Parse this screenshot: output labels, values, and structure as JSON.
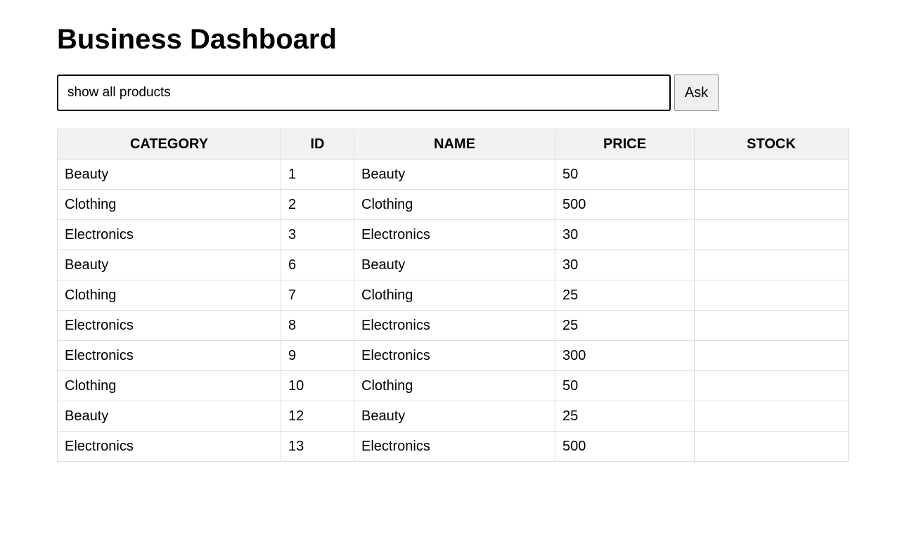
{
  "header": {
    "title": "Business Dashboard"
  },
  "query": {
    "value": "show all products",
    "ask_label": "Ask"
  },
  "table": {
    "columns": [
      "CATEGORY",
      "ID",
      "NAME",
      "PRICE",
      "STOCK"
    ],
    "rows": [
      [
        "Beauty",
        "1",
        "Beauty",
        "50",
        ""
      ],
      [
        "Clothing",
        "2",
        "Clothing",
        "500",
        ""
      ],
      [
        "Electronics",
        "3",
        "Electronics",
        "30",
        ""
      ],
      [
        "Beauty",
        "6",
        "Beauty",
        "30",
        ""
      ],
      [
        "Clothing",
        "7",
        "Clothing",
        "25",
        ""
      ],
      [
        "Electronics",
        "8",
        "Electronics",
        "25",
        ""
      ],
      [
        "Electronics",
        "9",
        "Electronics",
        "300",
        ""
      ],
      [
        "Clothing",
        "10",
        "Clothing",
        "50",
        ""
      ],
      [
        "Beauty",
        "12",
        "Beauty",
        "25",
        ""
      ],
      [
        "Electronics",
        "13",
        "Electronics",
        "500",
        ""
      ]
    ]
  }
}
